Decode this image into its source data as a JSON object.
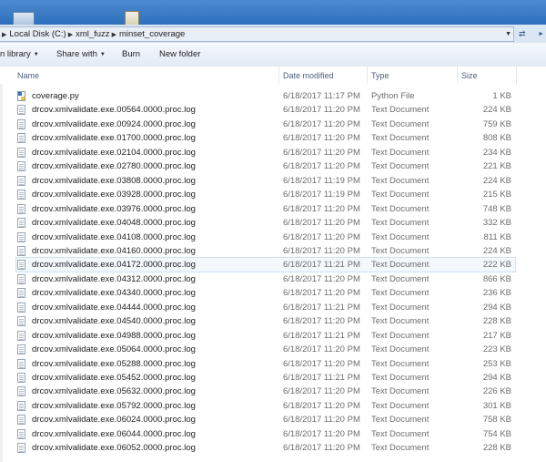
{
  "address": {
    "crumbs": [
      "Local Disk (C:)",
      "xml_fuzz",
      "minset_coverage"
    ]
  },
  "toolbar": {
    "include_library": "n library",
    "share_with": "Share with",
    "burn": "Burn",
    "new_folder": "New folder"
  },
  "columns": {
    "name": "Name",
    "date_modified": "Date modified",
    "type": "Type",
    "size": "Size"
  },
  "files": [
    {
      "name": "coverage.py",
      "date": "6/18/2017 11:17 PM",
      "type": "Python File",
      "size": "1 KB",
      "icon": "python-file-icon"
    },
    {
      "name": "drcov.xmlvalidate.exe.00564.0000.proc.log",
      "date": "6/18/2017 11:20 PM",
      "type": "Text Document",
      "size": "224 KB",
      "icon": "text-file-icon"
    },
    {
      "name": "drcov.xmlvalidate.exe.00924.0000.proc.log",
      "date": "6/18/2017 11:20 PM",
      "type": "Text Document",
      "size": "759 KB",
      "icon": "text-file-icon"
    },
    {
      "name": "drcov.xmlvalidate.exe.01700.0000.proc.log",
      "date": "6/18/2017 11:20 PM",
      "type": "Text Document",
      "size": "808 KB",
      "icon": "text-file-icon"
    },
    {
      "name": "drcov.xmlvalidate.exe.02104.0000.proc.log",
      "date": "6/18/2017 11:20 PM",
      "type": "Text Document",
      "size": "234 KB",
      "icon": "text-file-icon"
    },
    {
      "name": "drcov.xmlvalidate.exe.02780.0000.proc.log",
      "date": "6/18/2017 11:20 PM",
      "type": "Text Document",
      "size": "221 KB",
      "icon": "text-file-icon"
    },
    {
      "name": "drcov.xmlvalidate.exe.03808.0000.proc.log",
      "date": "6/18/2017 11:19 PM",
      "type": "Text Document",
      "size": "224 KB",
      "icon": "text-file-icon"
    },
    {
      "name": "drcov.xmlvalidate.exe.03928.0000.proc.log",
      "date": "6/18/2017 11:19 PM",
      "type": "Text Document",
      "size": "215 KB",
      "icon": "text-file-icon"
    },
    {
      "name": "drcov.xmlvalidate.exe.03976.0000.proc.log",
      "date": "6/18/2017 11:20 PM",
      "type": "Text Document",
      "size": "748 KB",
      "icon": "text-file-icon"
    },
    {
      "name": "drcov.xmlvalidate.exe.04048.0000.proc.log",
      "date": "6/18/2017 11:20 PM",
      "type": "Text Document",
      "size": "332 KB",
      "icon": "text-file-icon"
    },
    {
      "name": "drcov.xmlvalidate.exe.04108.0000.proc.log",
      "date": "6/18/2017 11:20 PM",
      "type": "Text Document",
      "size": "811 KB",
      "icon": "text-file-icon"
    },
    {
      "name": "drcov.xmlvalidate.exe.04160.0000.proc.log",
      "date": "6/18/2017 11:20 PM",
      "type": "Text Document",
      "size": "224 KB",
      "icon": "text-file-icon"
    },
    {
      "name": "drcov.xmlvalidate.exe.04172.0000.proc.log",
      "date": "6/18/2017 11:21 PM",
      "type": "Text Document",
      "size": "222 KB",
      "icon": "text-file-icon",
      "selected": true
    },
    {
      "name": "drcov.xmlvalidate.exe.04312.0000.proc.log",
      "date": "6/18/2017 11:20 PM",
      "type": "Text Document",
      "size": "866 KB",
      "icon": "text-file-icon"
    },
    {
      "name": "drcov.xmlvalidate.exe.04340.0000.proc.log",
      "date": "6/18/2017 11:20 PM",
      "type": "Text Document",
      "size": "236 KB",
      "icon": "text-file-icon"
    },
    {
      "name": "drcov.xmlvalidate.exe.04444.0000.proc.log",
      "date": "6/18/2017 11:21 PM",
      "type": "Text Document",
      "size": "294 KB",
      "icon": "text-file-icon"
    },
    {
      "name": "drcov.xmlvalidate.exe.04540.0000.proc.log",
      "date": "6/18/2017 11:20 PM",
      "type": "Text Document",
      "size": "228 KB",
      "icon": "text-file-icon"
    },
    {
      "name": "drcov.xmlvalidate.exe.04988.0000.proc.log",
      "date": "6/18/2017 11:21 PM",
      "type": "Text Document",
      "size": "217 KB",
      "icon": "text-file-icon"
    },
    {
      "name": "drcov.xmlvalidate.exe.05064.0000.proc.log",
      "date": "6/18/2017 11:20 PM",
      "type": "Text Document",
      "size": "223 KB",
      "icon": "text-file-icon"
    },
    {
      "name": "drcov.xmlvalidate.exe.05288.0000.proc.log",
      "date": "6/18/2017 11:20 PM",
      "type": "Text Document",
      "size": "253 KB",
      "icon": "text-file-icon"
    },
    {
      "name": "drcov.xmlvalidate.exe.05452.0000.proc.log",
      "date": "6/18/2017 11:21 PM",
      "type": "Text Document",
      "size": "294 KB",
      "icon": "text-file-icon"
    },
    {
      "name": "drcov.xmlvalidate.exe.05632.0000.proc.log",
      "date": "6/18/2017 11:20 PM",
      "type": "Text Document",
      "size": "226 KB",
      "icon": "text-file-icon"
    },
    {
      "name": "drcov.xmlvalidate.exe.05792.0000.proc.log",
      "date": "6/18/2017 11:20 PM",
      "type": "Text Document",
      "size": "301 KB",
      "icon": "text-file-icon"
    },
    {
      "name": "drcov.xmlvalidate.exe.06024.0000.proc.log",
      "date": "6/18/2017 11:20 PM",
      "type": "Text Document",
      "size": "758 KB",
      "icon": "text-file-icon"
    },
    {
      "name": "drcov.xmlvalidate.exe.06044.0000.proc.log",
      "date": "6/18/2017 11:20 PM",
      "type": "Text Document",
      "size": "754 KB",
      "icon": "text-file-icon"
    },
    {
      "name": "drcov.xmlvalidate.exe.06052.0000.proc.log",
      "date": "6/18/2017 11:20 PM",
      "type": "Text Document",
      "size": "228 KB",
      "icon": "text-file-icon"
    }
  ]
}
